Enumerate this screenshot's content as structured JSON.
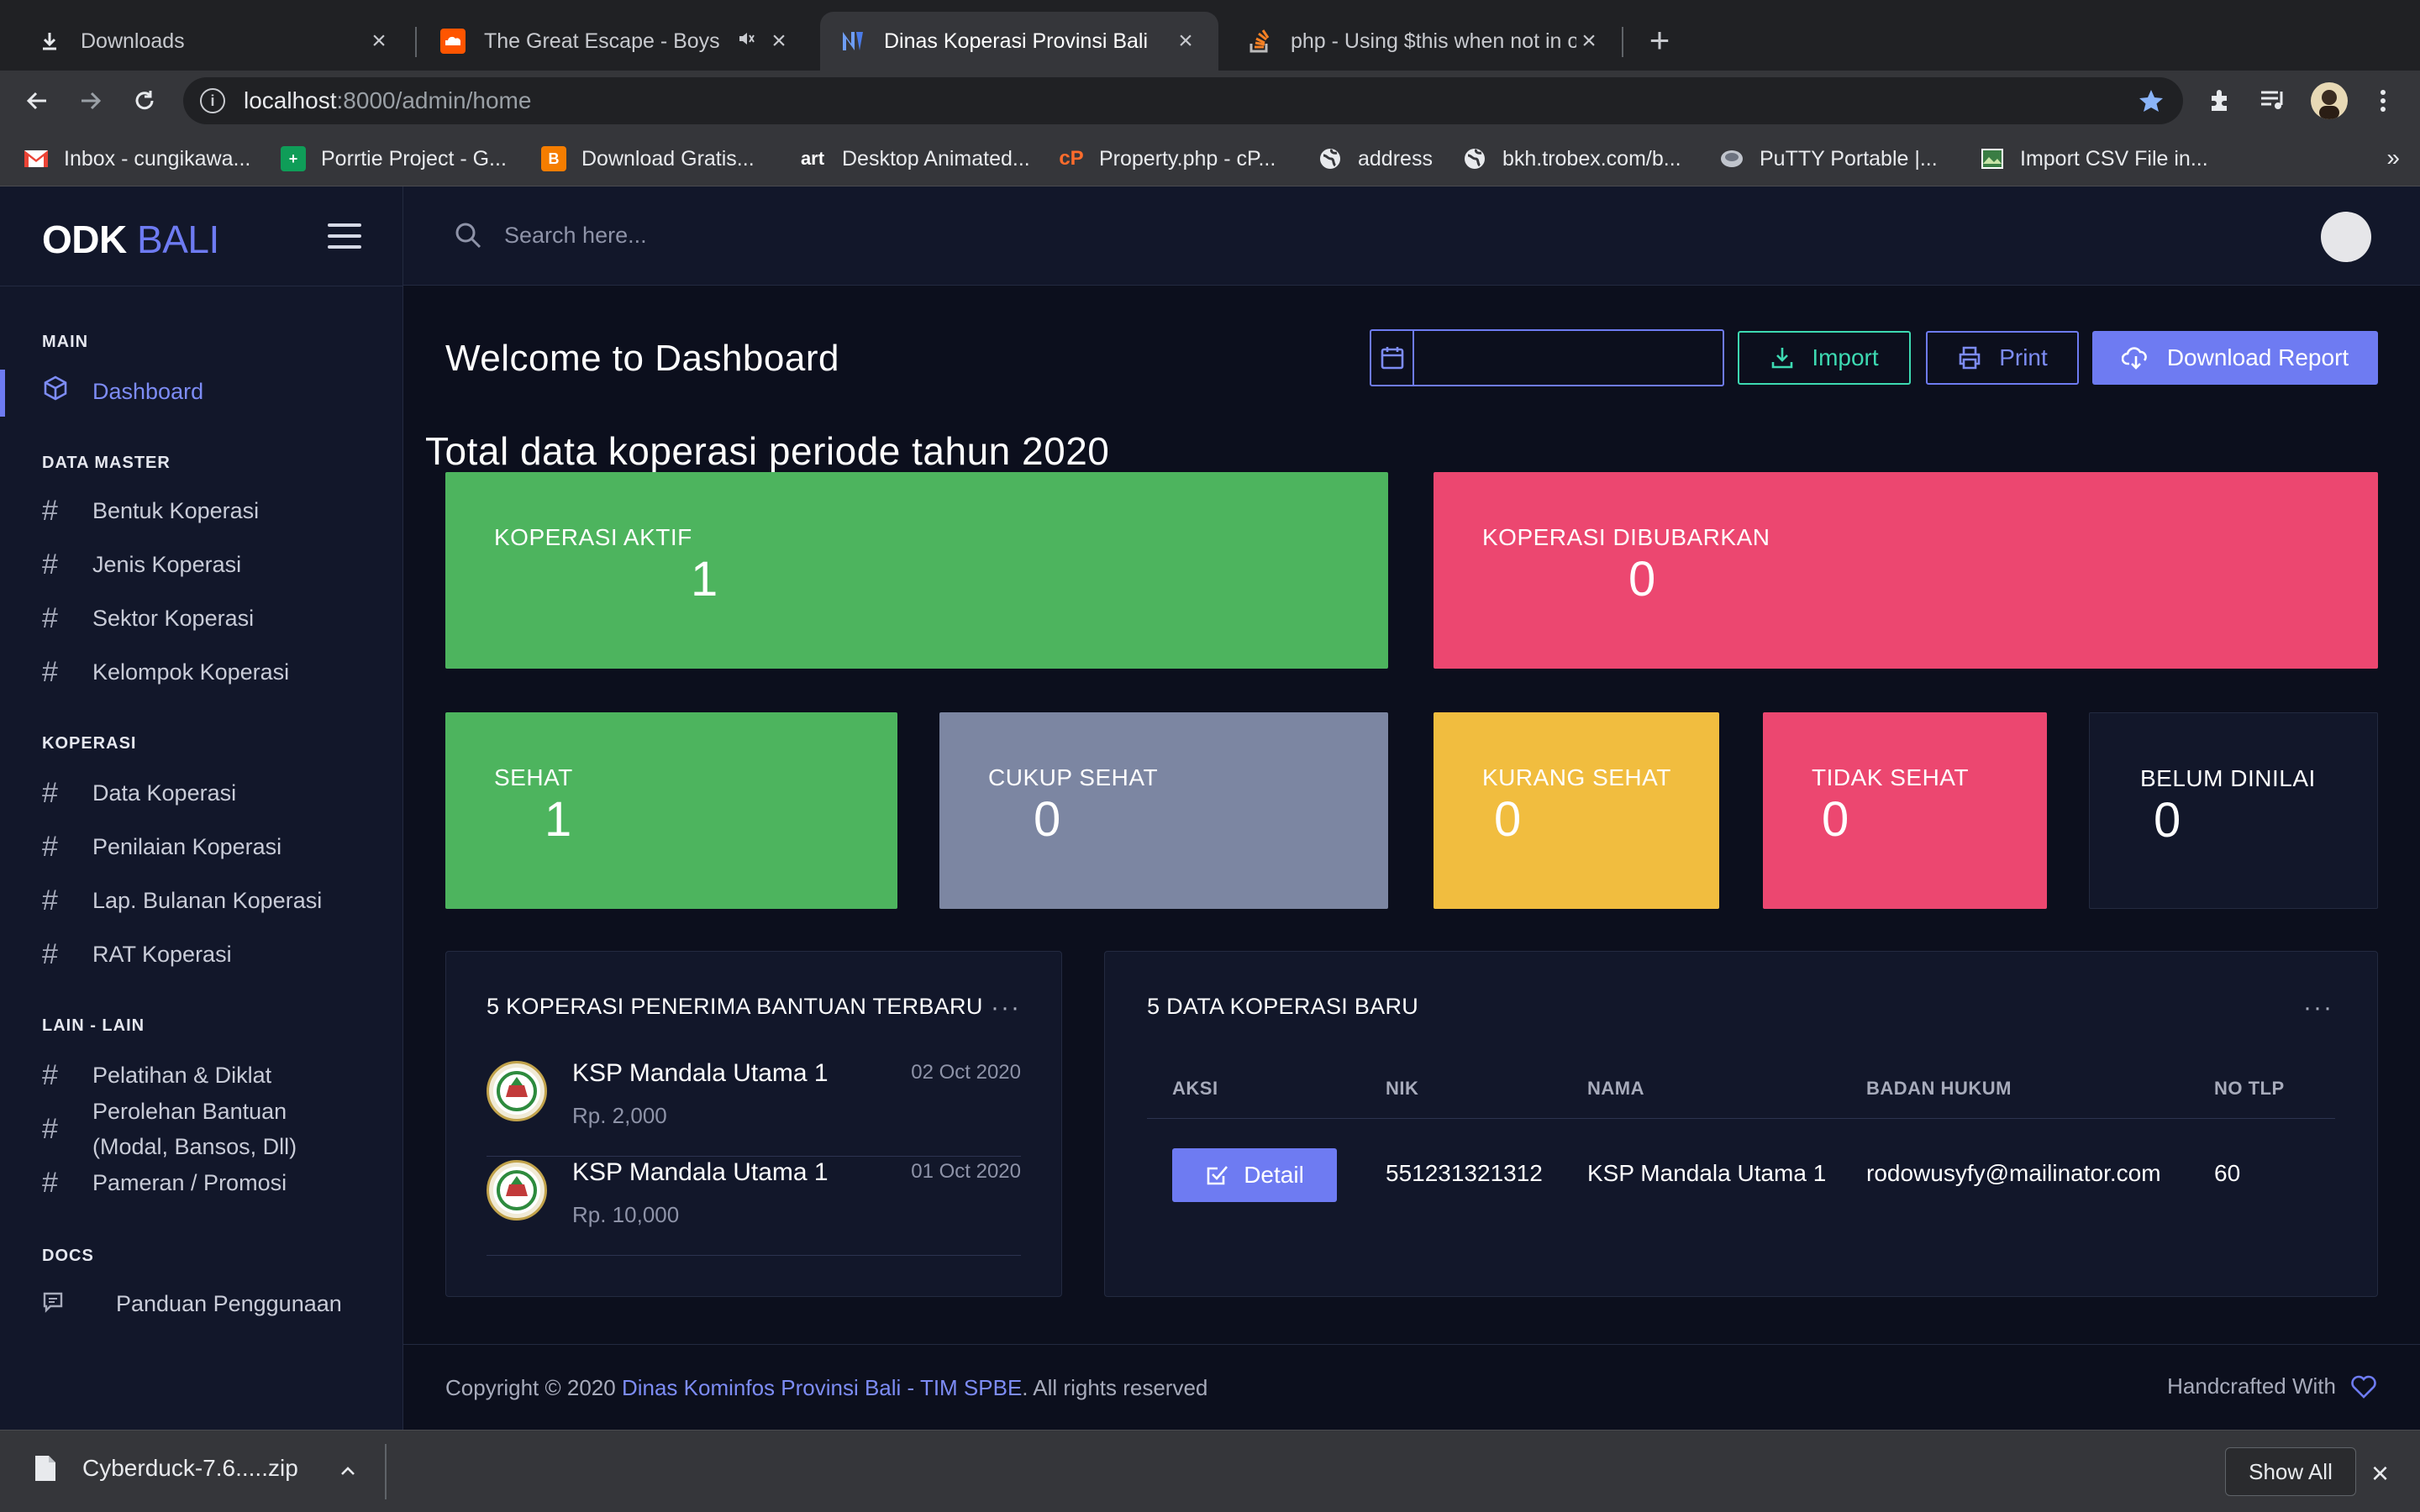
{
  "browser": {
    "tabs": [
      {
        "title": "Downloads",
        "icon": "download-icon"
      },
      {
        "title": "The Great Escape - Boys L",
        "icon": "soundcloud-icon"
      },
      {
        "title": "Dinas Koperasi Provinsi Bali",
        "icon": "app-logo-icon"
      },
      {
        "title": "php - Using $this when not in o",
        "icon": "stackoverflow-icon"
      }
    ],
    "url_host": "localhost",
    "url_path": ":8000/admin/home",
    "bookmarks": [
      "Inbox - cungikawa...",
      "Porrtie Project - G...",
      "Download Gratis...",
      "Desktop Animated...",
      "Property.php - cP...",
      "address",
      "bkh.trobex.com/b...",
      "PuTTY Portable |...",
      "Import CSV File in..."
    ],
    "bookmarks_more": "»"
  },
  "app": {
    "brand_bold": "ODK",
    "brand_light": "BALI",
    "search_placeholder": "Search here..."
  },
  "sidebar": {
    "sections": [
      {
        "title": "MAIN",
        "items": [
          "Dashboard"
        ]
      },
      {
        "title": "DATA MASTER",
        "items": [
          "Bentuk Koperasi",
          "Jenis Koperasi",
          "Sektor Koperasi",
          "Kelompok Koperasi"
        ]
      },
      {
        "title": "KOPERASI",
        "items": [
          "Data Koperasi",
          "Penilaian Koperasi",
          "Lap. Bulanan Koperasi",
          "RAT Koperasi"
        ]
      },
      {
        "title": "LAIN - LAIN",
        "items": [
          "Pelatihan & Diklat",
          "Perolehan Bantuan",
          "(Modal, Bansos, Dll)",
          "Pameran / Promosi"
        ]
      },
      {
        "title": "DOCS",
        "items": [
          "Panduan Penggunaan"
        ]
      }
    ]
  },
  "dashboard": {
    "welcome": "Welcome to Dashboard",
    "date_value": "",
    "import_label": "Import",
    "print_label": "Print",
    "download_label": "Download Report",
    "period_title": "Total data koperasi periode tahun 2020",
    "stats": [
      {
        "label": "KOPERASI AKTIF",
        "value": "1",
        "color": "#4db45e"
      },
      {
        "label": "KOPERASI DIBUBARKAN",
        "value": "0",
        "color": "#ec4770"
      },
      {
        "label": "SEHAT",
        "value": "1",
        "color": "#4db45e"
      },
      {
        "label": "CUKUP SEHAT",
        "value": "0",
        "color": "#7c86a2"
      },
      {
        "label": "KURANG SEHAT",
        "value": "0",
        "color": "#f1bd3f"
      },
      {
        "label": "TIDAK SEHAT",
        "value": "0",
        "color": "#ec4770"
      },
      {
        "label": "BELUM DINILAI",
        "value": "0",
        "color": "#12172a"
      }
    ]
  },
  "recipients": {
    "title": "5 KOPERASI PENERIMA BANTUAN TERBARU",
    "items": [
      {
        "name": "KSP Mandala Utama 1",
        "amount": "Rp. 2,000",
        "date": "02 Oct 2020"
      },
      {
        "name": "KSP Mandala Utama 1",
        "amount": "Rp. 10,000",
        "date": "01 Oct 2020"
      }
    ]
  },
  "new_koperasi": {
    "title": "5 DATA KOPERASI BARU",
    "columns": [
      "AKSI",
      "NIK",
      "NAMA",
      "BADAN HUKUM",
      "NO TLP"
    ],
    "rows": [
      {
        "action": "Detail",
        "nik": "551231321312",
        "nama": "KSP Mandala Utama 1",
        "badan_hukum": "rodowusyfy@mailinator.com",
        "no_tlp": "60"
      }
    ]
  },
  "footer": {
    "copyright_prefix": "Copyright © 2020 ",
    "link_text": "Dinas Kominfos Provinsi Bali - TIM SPBE",
    "copyright_suffix": ". All rights reserved",
    "right_text": "Handcrafted With"
  },
  "download_shelf": {
    "file": "Cyberduck-7.6.....zip",
    "show_all": "Show All"
  }
}
